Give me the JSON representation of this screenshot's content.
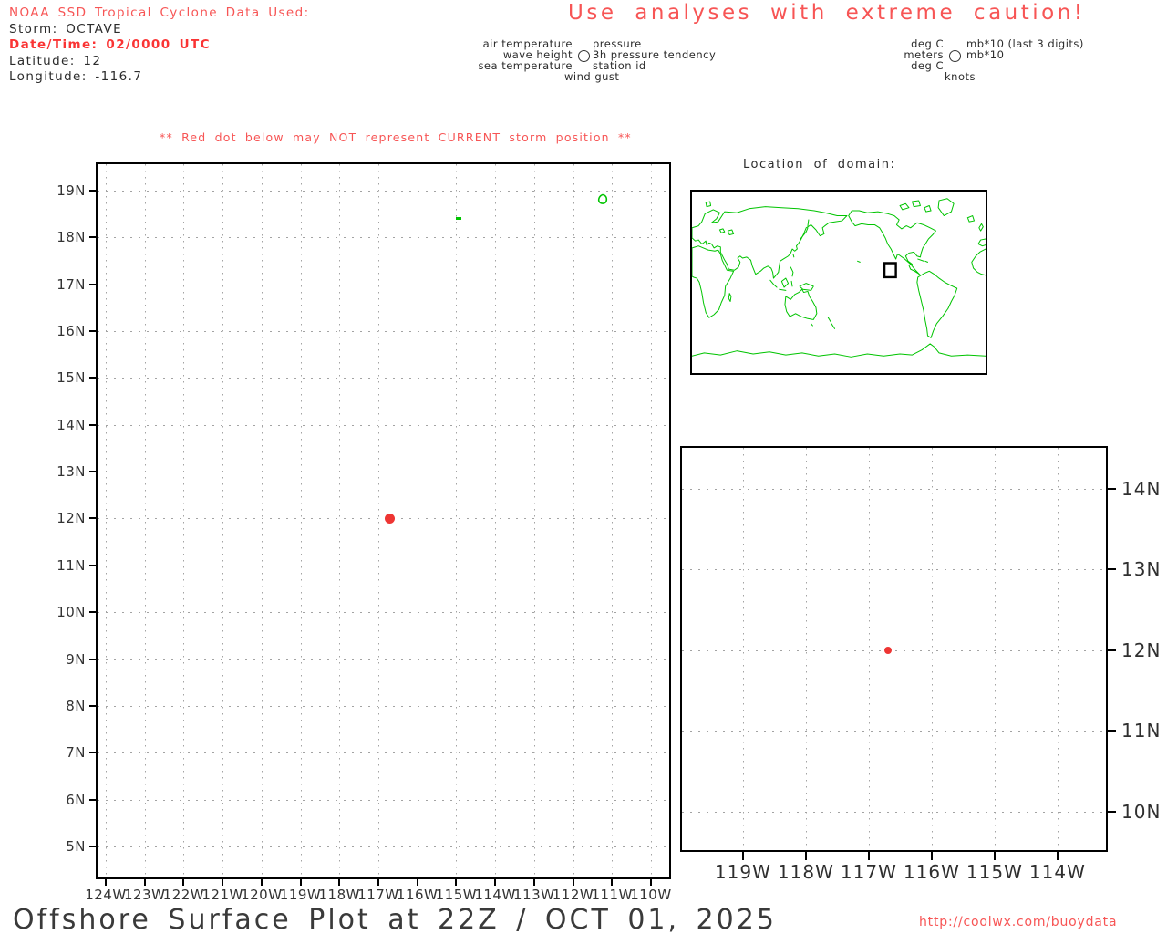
{
  "colors": {
    "red_text": "#f75555",
    "red_bold": "#fa3434",
    "dot_red": "#ee3533",
    "map_green": "#00c400",
    "grid_gray": "#a3a3a3"
  },
  "storm_info": {
    "source_line": "NOAA SSD Tropical Cyclone Data Used:",
    "storm_line": "Storm: OCTAVE",
    "datetime_line": "Date/Time: 02/0000 UTC",
    "latitude_line": "Latitude: 12",
    "longitude_line": "Longitude: -116.7"
  },
  "caution_title": "Use analyses with extreme caution!",
  "station_model_legend": {
    "left": [
      "air temperature",
      "wave height",
      "sea temperature"
    ],
    "bottom_left": "wind gust",
    "right": [
      "pressure",
      "3h pressure tendency",
      "station id"
    ],
    "circle_icon": "station-model-circle"
  },
  "units_legend": {
    "left": [
      "deg C",
      "meters",
      "deg C"
    ],
    "bottom_left": "knots",
    "right": [
      "mb*10 (last 3 digits)",
      "mb*10"
    ],
    "circle_icon": "station-model-circle"
  },
  "warning_line": "** Red dot below may NOT represent CURRENT storm position **",
  "inset_map": {
    "title": "Location of domain:",
    "domain": {
      "lon_min": -124,
      "lon_max": -110,
      "lat_min": 5,
      "lat_max": 19
    }
  },
  "footer": {
    "title": "Offshore Surface Plot at 22Z / OCT 01, 2025",
    "url": "http://coolwx.com/buoydata"
  },
  "chart_data": [
    {
      "id": "main_plot",
      "type": "scatter",
      "title": "Offshore surface plot domain",
      "x_ticks": [
        "124W",
        "123W",
        "122W",
        "121W",
        "120W",
        "119W",
        "118W",
        "117W",
        "116W",
        "115W",
        "114W",
        "113W",
        "112W",
        "111W",
        "110W"
      ],
      "y_ticks": [
        "19N",
        "18N",
        "17N",
        "16N",
        "15N",
        "14N",
        "13N",
        "12N",
        "11N",
        "10N",
        "9N",
        "8N",
        "7N",
        "6N",
        "5N"
      ],
      "xlim": [
        -124.2,
        -109.5
      ],
      "ylim": [
        4.3,
        19.6
      ],
      "grid": true,
      "points": [
        {
          "name": "storm-octave",
          "lon": -116.7,
          "lat": 12
        }
      ],
      "map_features": [
        {
          "shape": "ring",
          "name": "island-outline",
          "lon": -111.25,
          "lat": 18.83
        },
        {
          "shape": "speck",
          "name": "island-speck",
          "lon": -114.95,
          "lat": 18.4
        }
      ]
    },
    {
      "id": "zoom_plot",
      "type": "scatter",
      "title": "Zoomed domain around storm",
      "x_ticks": [
        "119W",
        "118W",
        "117W",
        "116W",
        "115W",
        "114W"
      ],
      "y_ticks": [
        "14N",
        "13N",
        "12N",
        "11N",
        "10N"
      ],
      "xlim": [
        -120.0,
        -113.2
      ],
      "ylim": [
        9.5,
        14.5
      ],
      "grid": true,
      "points": [
        {
          "name": "storm-octave",
          "lon": -116.7,
          "lat": 12
        }
      ]
    }
  ]
}
